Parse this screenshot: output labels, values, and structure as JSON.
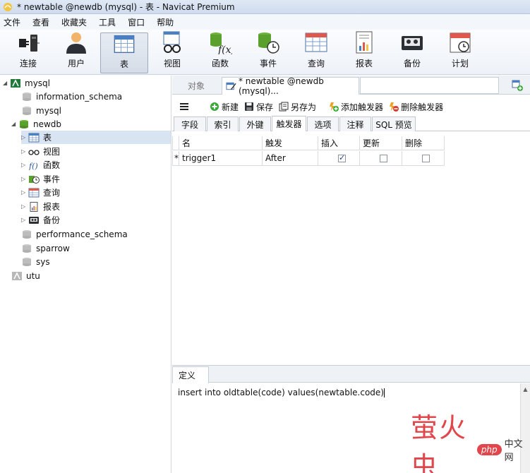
{
  "window": {
    "title": "* newtable @newdb (mysql) - 表 - Navicat Premium"
  },
  "menubar": [
    "文件",
    "查看",
    "收藏夹",
    "工具",
    "窗口",
    "帮助"
  ],
  "toolbar": {
    "items": [
      {
        "label": "连接",
        "icon": "plug-icon"
      },
      {
        "label": "用户",
        "icon": "user-icon"
      },
      {
        "label": "表",
        "icon": "table-icon",
        "active": true
      },
      {
        "label": "视图",
        "icon": "view-icon"
      },
      {
        "label": "函数",
        "icon": "function-icon"
      },
      {
        "label": "事件",
        "icon": "event-icon"
      },
      {
        "label": "查询",
        "icon": "query-icon"
      },
      {
        "label": "报表",
        "icon": "report-icon"
      },
      {
        "label": "备份",
        "icon": "backup-icon"
      },
      {
        "label": "计划",
        "icon": "schedule-icon"
      }
    ]
  },
  "sidebar": {
    "tree": [
      {
        "label": "mysql",
        "level": 0,
        "expander": "◢",
        "icon": "connection-icon"
      },
      {
        "label": "information_schema",
        "level": 1,
        "icon": "database-icon"
      },
      {
        "label": "mysql",
        "level": 1,
        "icon": "database-icon"
      },
      {
        "label": "newdb",
        "level": 1,
        "expander": "◢",
        "icon": "database-open-icon"
      },
      {
        "label": "表",
        "level": 2,
        "expander": "▷",
        "icon": "table-icon",
        "selected": true
      },
      {
        "label": "视图",
        "level": 2,
        "expander": "▷",
        "icon": "view-icon"
      },
      {
        "label": "函数",
        "level": 2,
        "expander": "▷",
        "icon": "function-icon"
      },
      {
        "label": "事件",
        "level": 2,
        "expander": "▷",
        "icon": "event-icon"
      },
      {
        "label": "查询",
        "level": 2,
        "expander": "▷",
        "icon": "query-icon"
      },
      {
        "label": "报表",
        "level": 2,
        "expander": "▷",
        "icon": "report-icon"
      },
      {
        "label": "备份",
        "level": 2,
        "expander": "▷",
        "icon": "backup-icon"
      },
      {
        "label": "performance_schema",
        "level": 1,
        "icon": "database-icon"
      },
      {
        "label": "sparrow",
        "level": 1,
        "icon": "database-icon"
      },
      {
        "label": "sys",
        "level": 1,
        "icon": "database-icon"
      },
      {
        "label": "utu",
        "level": 0,
        "icon": "connection-icon"
      }
    ]
  },
  "tabs": {
    "objects": "对象",
    "document": "* newtable @newdb (mysql)..."
  },
  "objbar": {
    "menu_icon": "hamburger-icon",
    "new": "新建",
    "save": "保存",
    "save_as": "另存为",
    "add_trigger": "添加触发器",
    "delete_trigger": "删除触发器"
  },
  "subtabs": [
    "字段",
    "索引",
    "外键",
    "触发器",
    "选项",
    "注释",
    "SQL 预览"
  ],
  "trigger_grid": {
    "headers": [
      "名",
      "触发",
      "插入",
      "更新",
      "删除"
    ],
    "rows": [
      {
        "marker": "*",
        "name": "trigger1",
        "fire": "After",
        "insert": true,
        "update": false,
        "delete": false
      }
    ]
  },
  "definition": {
    "tab": "定义",
    "code": "insert into oldtable(code) values(newtable.code)"
  },
  "watermark": {
    "text": "萤火虫",
    "badge": "php",
    "sub": "中文网"
  },
  "colors": {
    "accent": "#2b6cb0",
    "selection": "#d9e4f3",
    "watermark": "#e0464b"
  }
}
